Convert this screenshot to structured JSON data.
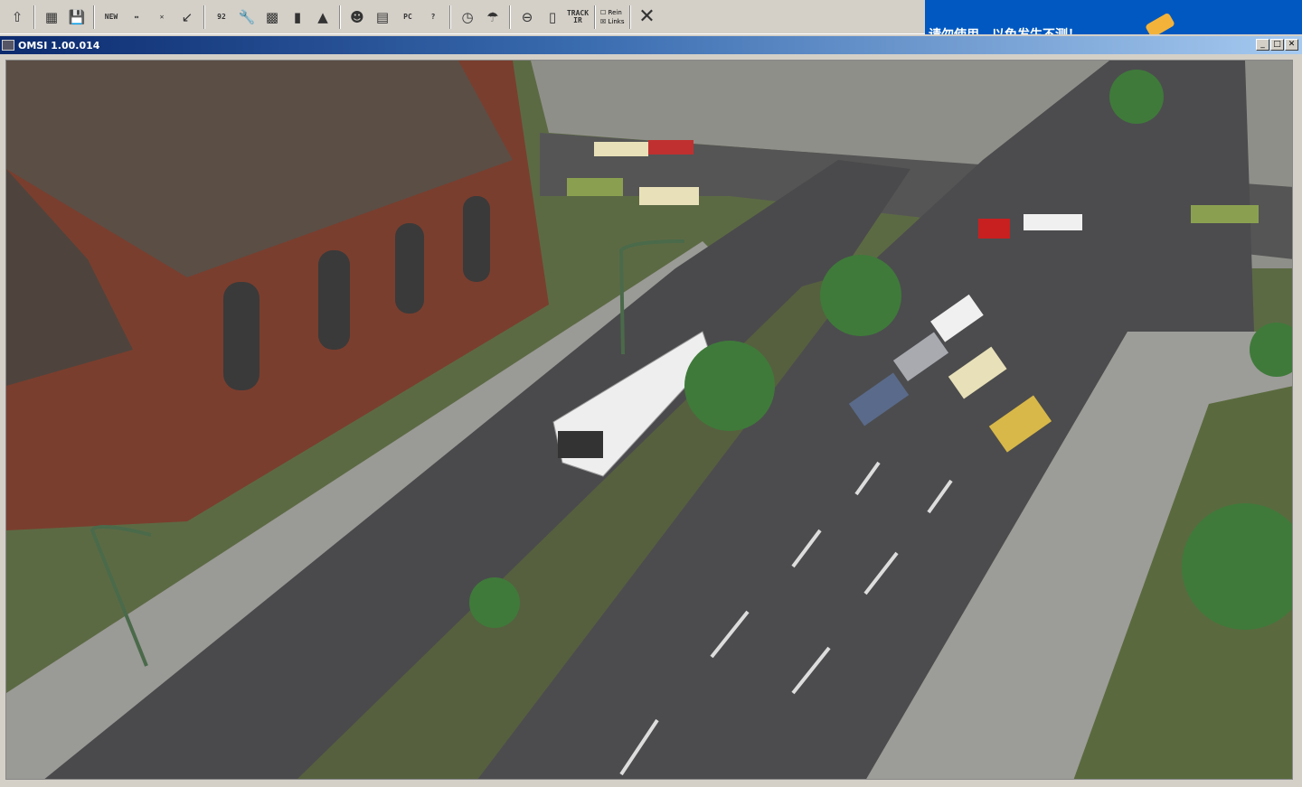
{
  "toolbar": {
    "buttons": [
      {
        "icon": "arrow-up-icon"
      },
      {
        "icon": "map-icon"
      },
      {
        "icon": "save-icon"
      },
      {
        "icon": "new-bus-icon",
        "label": "NEW"
      },
      {
        "icon": "change-bus-icon",
        "label": "↔"
      },
      {
        "icon": "remove-bus-icon",
        "label": "✕"
      },
      {
        "icon": "arrow-down-left-icon"
      },
      {
        "icon": "line-number-icon",
        "label": "92"
      },
      {
        "icon": "wrench-icon"
      },
      {
        "icon": "chip-icon"
      },
      {
        "icon": "fuel-icon"
      },
      {
        "icon": "blue-light-icon"
      },
      {
        "icon": "driver-icon"
      },
      {
        "icon": "timetable-icon"
      },
      {
        "icon": "pc-driver-swap-icon",
        "label": "PC"
      },
      {
        "icon": "help-arrow-icon",
        "label": "?"
      },
      {
        "icon": "clock-icon"
      },
      {
        "icon": "weather-icon"
      },
      {
        "icon": "steering-wheel-icon"
      },
      {
        "icon": "mouse-icon"
      },
      {
        "icon": "trackir-icon",
        "label": "TRACK IR"
      }
    ],
    "checkbox_1": {
      "label": "Rein",
      "checked": false
    },
    "checkbox_2": {
      "label": "Links",
      "checked": true
    },
    "close_label": "✕"
  },
  "desktop_banner": {
    "text": "请勿使用，以免发生不测！"
  },
  "window": {
    "title": "OMSI 1.00.014",
    "minimize": "_",
    "maximize": "□",
    "close": "✕"
  },
  "colors": {
    "titlebar_start": "#0c2a6e",
    "titlebar_end": "#a6caf0",
    "toolbar": "#d4d0c8",
    "desktop": "#0058c0"
  }
}
